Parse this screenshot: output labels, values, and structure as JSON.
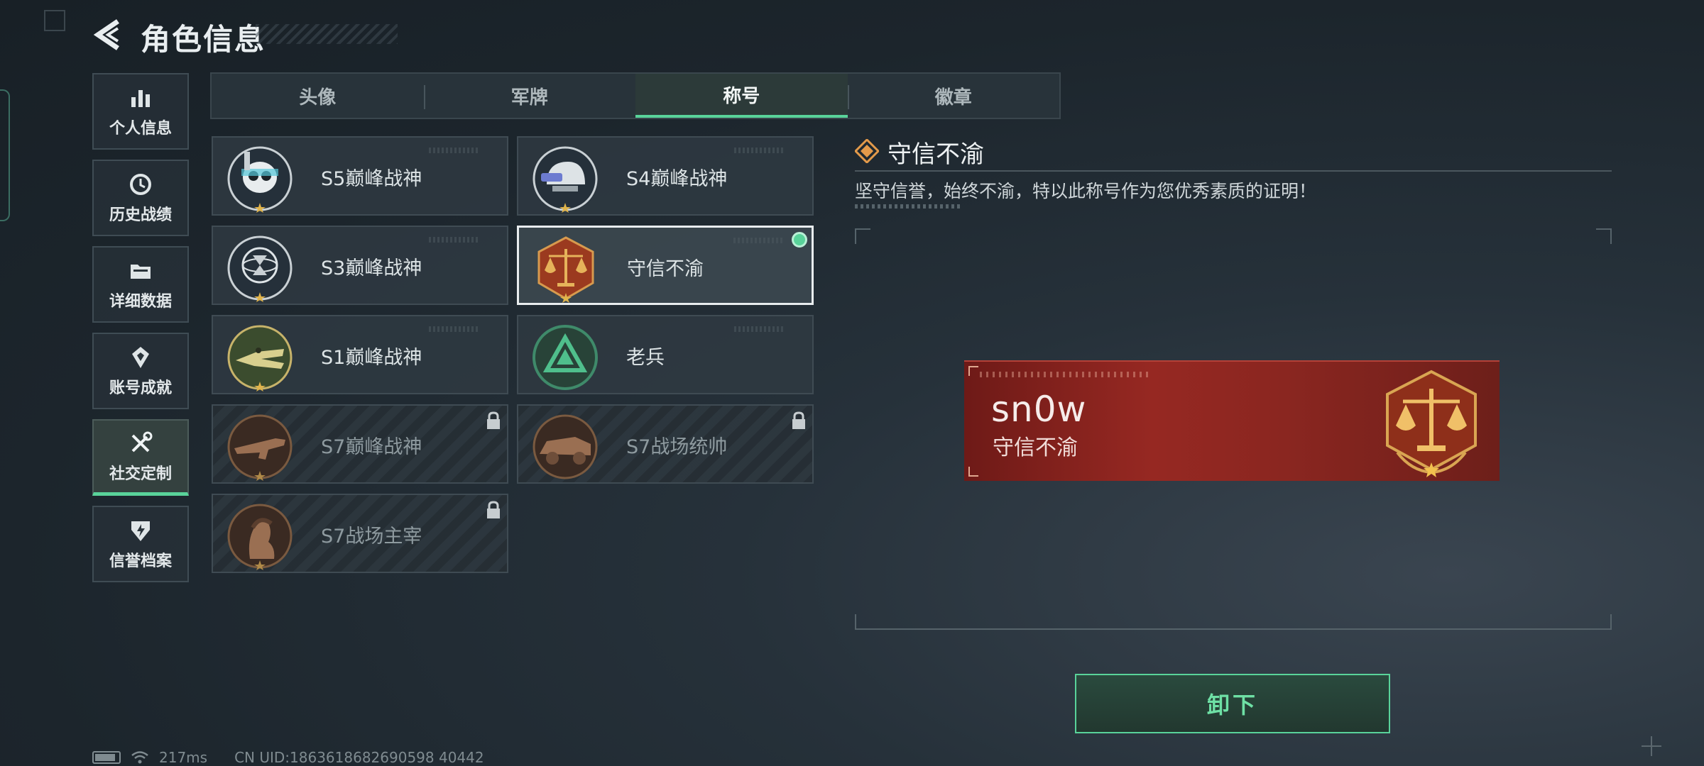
{
  "header": {
    "title": "角色信息"
  },
  "sidebar": {
    "items": [
      {
        "label": "个人信息",
        "icon": "bar-chart-icon",
        "active": false
      },
      {
        "label": "历史战绩",
        "icon": "history-clock-icon",
        "active": false
      },
      {
        "label": "详细数据",
        "icon": "folder-icon",
        "active": false
      },
      {
        "label": "账号成就",
        "icon": "achievement-icon",
        "active": false
      },
      {
        "label": "社交定制",
        "icon": "tools-icon",
        "active": true
      },
      {
        "label": "信誉档案",
        "icon": "shield-icon",
        "active": false
      }
    ]
  },
  "tabs": [
    {
      "label": "头像",
      "active": false
    },
    {
      "label": "军牌",
      "active": false
    },
    {
      "label": "称号",
      "active": true
    },
    {
      "label": "徽章",
      "active": false
    }
  ],
  "titles": [
    {
      "name": "S5巅峰战神",
      "icon": "skull-diver-emblem-icon",
      "locked": false,
      "selected": false
    },
    {
      "name": "S4巅峰战神",
      "icon": "helmet-emblem-icon",
      "locked": false,
      "selected": false
    },
    {
      "name": "S3巅峰战神",
      "icon": "globe-hourglass-emblem-icon",
      "locked": false,
      "selected": false
    },
    {
      "name": "守信不渝",
      "icon": "scales-emblem-icon",
      "locked": false,
      "selected": true
    },
    {
      "name": "S1巅峰战神",
      "icon": "crocodile-emblem-icon",
      "locked": false,
      "selected": false
    },
    {
      "name": "老兵",
      "icon": "veteran-triangle-emblem-icon",
      "locked": false,
      "selected": false
    },
    {
      "name": "S7巅峰战神",
      "icon": "rifle-emblem-icon",
      "locked": true,
      "selected": false
    },
    {
      "name": "S7战场统帅",
      "icon": "vehicle-emblem-icon",
      "locked": true,
      "selected": false
    },
    {
      "name": "S7战场主宰",
      "icon": "soldier-portrait-emblem-icon",
      "locked": true,
      "selected": false
    }
  ],
  "detail": {
    "title": "守信不渝",
    "description": "坚守信誉，始终不渝，特以此称号作为您优秀素质的证明！",
    "preview_player": "sn0w",
    "preview_title": "守信不渝"
  },
  "actions": {
    "unequip_label": "卸下"
  },
  "status": {
    "ping": "217ms",
    "uid": "CN UID:1863618682690598 40442"
  },
  "colors": {
    "accent": "#59d39a",
    "preview_red": "#962822",
    "background": "#1c252c"
  }
}
